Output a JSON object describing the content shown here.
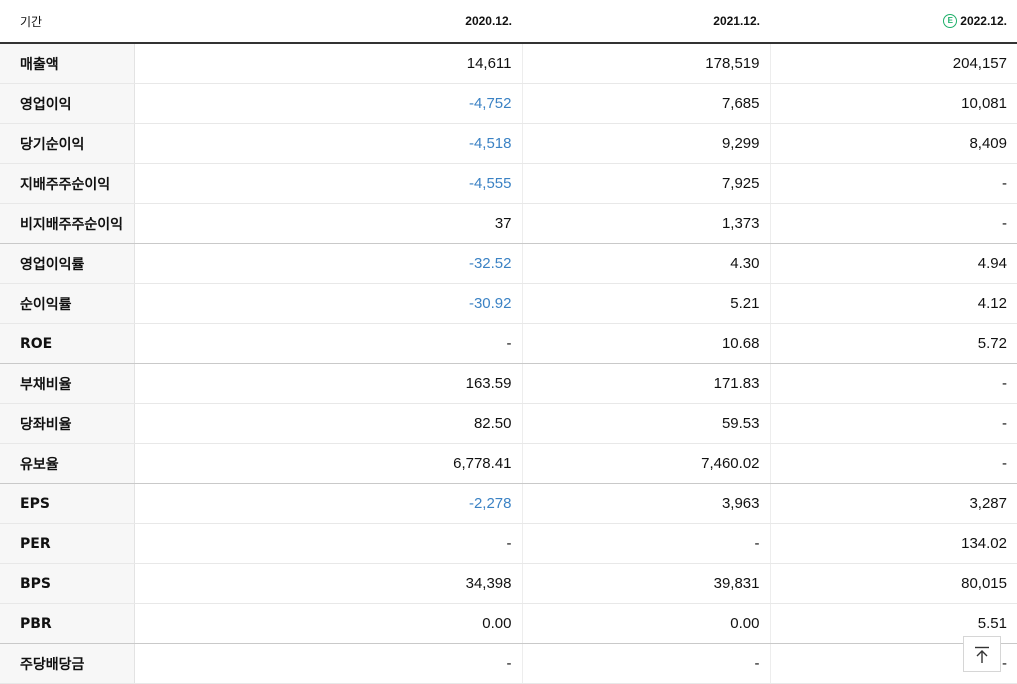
{
  "header": {
    "label": "기간",
    "periods": [
      "2020.12.",
      "2021.12.",
      "2022.12."
    ],
    "estimate_marker": "E"
  },
  "rows": [
    {
      "label": "매출액",
      "values": [
        "14,611",
        "178,519",
        "204,157"
      ],
      "neg": [
        false,
        false,
        false
      ]
    },
    {
      "label": "영업이익",
      "values": [
        "-4,752",
        "7,685",
        "10,081"
      ],
      "neg": [
        true,
        false,
        false
      ]
    },
    {
      "label": "당기순이익",
      "values": [
        "-4,518",
        "9,299",
        "8,409"
      ],
      "neg": [
        true,
        false,
        false
      ]
    },
    {
      "label": "지배주주순이익",
      "values": [
        "-4,555",
        "7,925",
        "-"
      ],
      "neg": [
        true,
        false,
        false
      ]
    },
    {
      "label": "비지배주주순이익",
      "values": [
        "37",
        "1,373",
        "-"
      ],
      "neg": [
        false,
        false,
        false
      ]
    },
    {
      "label": "영업이익률",
      "values": [
        "-32.52",
        "4.30",
        "4.94"
      ],
      "neg": [
        true,
        false,
        false
      ]
    },
    {
      "label": "순이익률",
      "values": [
        "-30.92",
        "5.21",
        "4.12"
      ],
      "neg": [
        true,
        false,
        false
      ]
    },
    {
      "label": "ROE",
      "values": [
        "-",
        "10.68",
        "5.72"
      ],
      "neg": [
        false,
        false,
        false
      ]
    },
    {
      "label": "부채비율",
      "values": [
        "163.59",
        "171.83",
        "-"
      ],
      "neg": [
        false,
        false,
        false
      ]
    },
    {
      "label": "당좌비율",
      "values": [
        "82.50",
        "59.53",
        "-"
      ],
      "neg": [
        false,
        false,
        false
      ]
    },
    {
      "label": "유보율",
      "values": [
        "6,778.41",
        "7,460.02",
        "-"
      ],
      "neg": [
        false,
        false,
        false
      ]
    },
    {
      "label": "EPS",
      "values": [
        "-2,278",
        "3,963",
        "3,287"
      ],
      "neg": [
        true,
        false,
        false
      ]
    },
    {
      "label": "PER",
      "values": [
        "-",
        "-",
        "134.02"
      ],
      "neg": [
        false,
        false,
        false
      ]
    },
    {
      "label": "BPS",
      "values": [
        "34,398",
        "39,831",
        "80,015"
      ],
      "neg": [
        false,
        false,
        false
      ]
    },
    {
      "label": "PBR",
      "values": [
        "0.00",
        "0.00",
        "5.51"
      ],
      "neg": [
        false,
        false,
        false
      ]
    },
    {
      "label": "주당배당금",
      "values": [
        "-",
        "-",
        "-"
      ],
      "neg": [
        false,
        false,
        false
      ]
    }
  ],
  "colors": {
    "negative": "#3b82c4",
    "estimate": "#1fb06a"
  },
  "scroll_top_icon": "arrow-up-to-top-icon"
}
